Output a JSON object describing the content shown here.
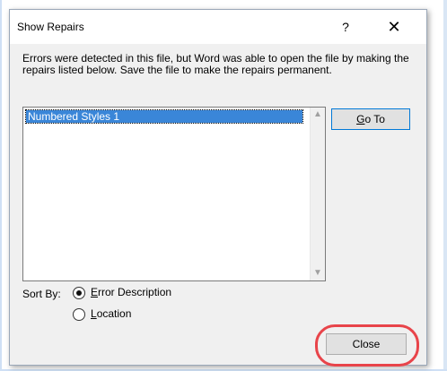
{
  "dialog": {
    "title": "Show Repairs",
    "help_label": "?",
    "close_glyph": "✕",
    "message": "Errors were detected in this file, but Word was able to open the file by making the repairs listed below.  Save the file to make the repairs permanent."
  },
  "repairs": {
    "items": [
      {
        "label": "Numbered Styles 1"
      }
    ]
  },
  "buttons": {
    "goto_hotkey": "G",
    "goto_rest": "o To",
    "close_label": "Close"
  },
  "sort": {
    "label": "Sort By:",
    "options": [
      {
        "hotkey": "E",
        "rest": "rror Description",
        "selected": true
      },
      {
        "hotkey": "L",
        "rest": "ocation",
        "selected": false
      }
    ]
  },
  "icons": {
    "scroll_up": "chevron-up-icon",
    "scroll_down": "chevron-down-icon"
  },
  "colors": {
    "selection": "#3a86d8",
    "highlight_ring": "#e8444a"
  }
}
